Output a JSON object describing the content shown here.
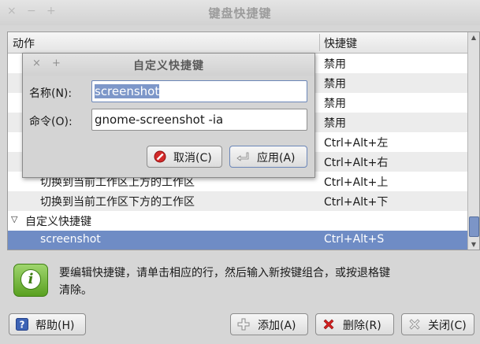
{
  "window": {
    "title": "键盘快捷键",
    "controls": [
      "×",
      "−",
      "+"
    ]
  },
  "table": {
    "headers": {
      "action": "动作",
      "shortcut": "快捷键"
    },
    "rows": [
      {
        "action": "",
        "shortcut": "禁用",
        "alt": false
      },
      {
        "action": "",
        "shortcut": "禁用",
        "alt": true
      },
      {
        "action": "",
        "shortcut": "禁用",
        "alt": false
      },
      {
        "action": "",
        "shortcut": "禁用",
        "alt": true
      },
      {
        "action": "",
        "shortcut": "Ctrl+Alt+左",
        "alt": false
      },
      {
        "action": "",
        "shortcut": "Ctrl+Alt+右",
        "alt": true
      },
      {
        "action": "切换到当前工作区上方的工作区",
        "shortcut": "Ctrl+Alt+上",
        "alt": false
      },
      {
        "action": "切换到当前工作区下方的工作区",
        "shortcut": "Ctrl+Alt+下",
        "alt": true
      }
    ],
    "group": {
      "expander": "▽",
      "label": "自定义快捷键"
    },
    "selected_row": {
      "action": "screenshot",
      "shortcut": "Ctrl+Alt+S"
    }
  },
  "info": {
    "text": "要编辑快捷键，请单击相应的行，然后输入新按键组合，或按退格键清除。"
  },
  "buttons": {
    "help": "帮助(H)",
    "add": "添加(A)",
    "remove": "删除(R)",
    "close": "关闭(C)"
  },
  "dialog": {
    "title": "自定义快捷键",
    "controls": [
      "×",
      "+"
    ],
    "name_label": "名称(N):",
    "name_value": "screenshot",
    "command_label": "命令(O):",
    "command_value": "gnome-screenshot -ia",
    "cancel": "取消(C)",
    "apply": "应用(A)"
  },
  "colors": {
    "selection": "#6f8cc5",
    "window_bg": "#d6d6d6"
  }
}
